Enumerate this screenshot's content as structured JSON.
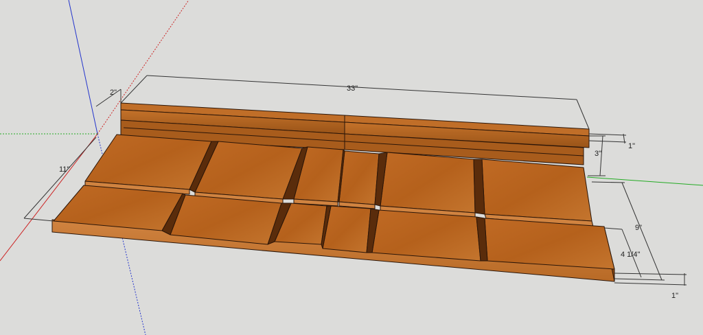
{
  "model": {
    "colors": {
      "background": "#dcdcda",
      "wood_top": "#b8651f",
      "wood_top_light": "#c8772c",
      "wood_front": "#c77a32",
      "wood_side": "#8a4712",
      "wood_dark": "#5a2c0b",
      "edge": "#2a1508",
      "axis_red": "#cc2222",
      "axis_green": "#22aa22",
      "axis_blue": "#2233cc",
      "dimension": "#333333"
    }
  },
  "dimensions": {
    "fence_depth": "2\"",
    "total_length": "33\"",
    "board_depth": "11\"",
    "fence_thickness": "1\"",
    "fence_height": "3\"",
    "slot_spacing": "9\"",
    "slot_offset": "4 1/4\"",
    "base_thickness": "1\""
  }
}
